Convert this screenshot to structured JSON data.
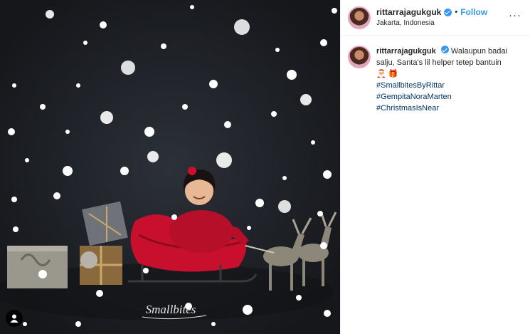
{
  "post": {
    "username": "rittarrajagukguk",
    "location": "Jakarta, Indonesia",
    "follow_label": "Follow",
    "separator": "•",
    "more_label": "···"
  },
  "caption": {
    "username": "rittarrajagukguk",
    "text": "Walaupun badai salju, Santa's lil helper tetep bantuin",
    "emoji_1": "🎅",
    "emoji_2": "🎁",
    "hashtags": [
      "#SmallbitesByRittar",
      "#GempitaNoraMarten",
      "#ChristmasIsNear"
    ]
  },
  "photo": {
    "watermark": "Smallbites"
  },
  "colors": {
    "accent": "#3897f0",
    "hashtag": "#00376b",
    "sleigh": "#c8102e"
  }
}
